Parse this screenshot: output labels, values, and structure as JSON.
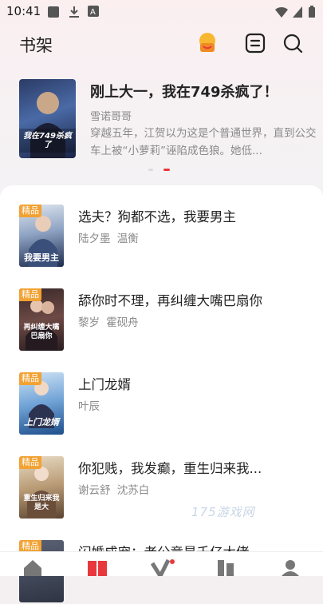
{
  "status": {
    "time": "10:41"
  },
  "header": {
    "title": "书架"
  },
  "featured": {
    "title": "刚上大一，我在749杀疯了！",
    "author": "雪诺哥哥",
    "description": "穿越五年，江贺以为这是个普通世界，直到公交车上被“小萝莉”诬陷成色狼。她低...",
    "cover_text": "我在749杀疯了"
  },
  "books": [
    {
      "title": "选夫？狗都不选，我要男主",
      "authors": "陆夕墨  温衡",
      "badge": "精品",
      "cover_text": "我要男主"
    },
    {
      "title": "舔你时不理，再纠缠大嘴巴扇你",
      "authors": "黎岁  霍砚舟",
      "badge": "精品",
      "cover_text": "再纠缠大嘴巴扇你"
    },
    {
      "title": "上门龙婿",
      "authors": "叶辰",
      "badge": "精品",
      "cover_text": "上门龙婿"
    },
    {
      "title": "你犯贱，我发癫，重生归来我...",
      "authors": "谢云舒  沈苏白",
      "badge": "精品",
      "cover_text": "重生归来我是大"
    },
    {
      "title": "闪婚成宠：老公竟是千亿大佬",
      "authors": "",
      "badge": "精品",
      "cover_text": ""
    }
  ],
  "watermark": "175游戏网",
  "colors": {
    "accent": "#e8383d",
    "badge": "#f1a232"
  },
  "icons": {
    "header": [
      "gift-icon",
      "list-icon",
      "search-icon"
    ],
    "tabs": [
      "home-icon",
      "bookshelf-icon",
      "v-icon",
      "category-icon",
      "profile-icon"
    ]
  }
}
